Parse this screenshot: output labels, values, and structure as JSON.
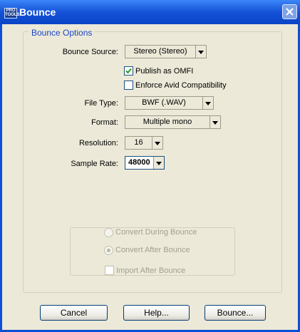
{
  "window": {
    "title": "Bounce",
    "icon_label": "PRO TOOLS",
    "icon": "pro-tools-icon",
    "close_icon": "close-icon"
  },
  "options": {
    "legend": "Bounce Options",
    "bounce_source": {
      "label": "Bounce Source:",
      "value": "Stereo (Stereo)"
    },
    "publish_omfi": {
      "label": "Publish as OMFI",
      "checked": true
    },
    "enforce_avid": {
      "label": "Enforce Avid Compatibility",
      "checked": false
    },
    "file_type": {
      "label": "File Type:",
      "value": "BWF (.WAV)"
    },
    "format": {
      "label": "Format:",
      "value": "Multiple mono"
    },
    "resolution": {
      "label": "Resolution:",
      "value": "16"
    },
    "sample_rate": {
      "label": "Sample Rate:",
      "value": "48000"
    },
    "conversion": {
      "during": {
        "label": "Convert During Bounce",
        "selected": false,
        "enabled": false
      },
      "after": {
        "label": "Convert After Bounce",
        "selected": true,
        "enabled": false
      },
      "import": {
        "label": "Import After Bounce",
        "checked": false,
        "enabled": false
      }
    }
  },
  "buttons": {
    "cancel": "Cancel",
    "help": "Help...",
    "bounce": "Bounce..."
  },
  "colors": {
    "title_bar": "#0a4fd6",
    "legend_text": "#1b46c8",
    "dialog_bg": "#ece9d8"
  }
}
